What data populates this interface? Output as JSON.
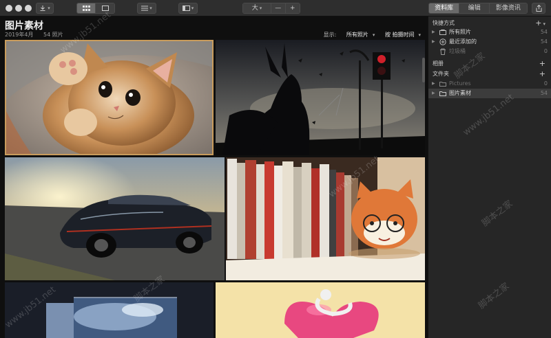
{
  "toolbar": {
    "size_label": "大",
    "minus_label": "—",
    "plus_label": "+",
    "tabs": [
      {
        "label": "资料库",
        "active": true
      },
      {
        "label": "编辑",
        "active": false
      },
      {
        "label": "影像资讯",
        "active": false
      }
    ]
  },
  "main": {
    "title": "图片素材",
    "date": "2019年4月",
    "count": "54 照片",
    "show_label": "显示:",
    "show_value": "所有照片",
    "sort_label": "按 拍摄时间"
  },
  "sidebar": {
    "shortcuts_label": "快捷方式",
    "shortcuts": [
      {
        "label": "所有照片",
        "count": "54",
        "icon": "photos-icon"
      },
      {
        "label": "最近添加的",
        "count": "54",
        "icon": "recent-icon"
      },
      {
        "label": "垃圾桶",
        "count": "0",
        "icon": "trash-icon"
      }
    ],
    "albums_label": "相册",
    "folders_label": "文件夹",
    "folders": [
      {
        "label": "Pictures",
        "count": "0"
      },
      {
        "label": "图片素材",
        "count": "54"
      }
    ]
  },
  "watermarks": [
    "www.jb51.net",
    "脚本之家"
  ]
}
